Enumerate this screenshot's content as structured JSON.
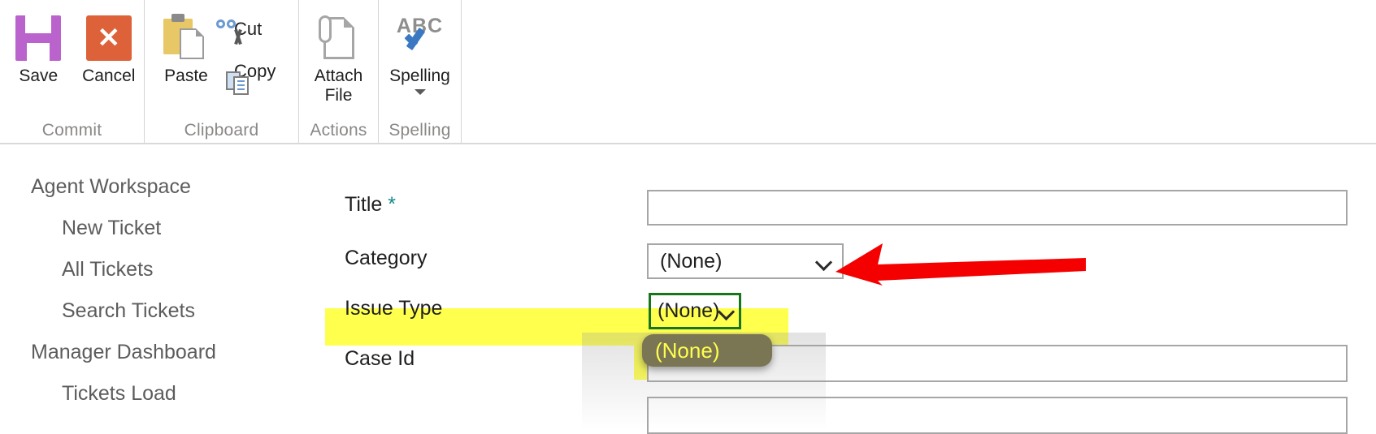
{
  "ribbon": {
    "groups": [
      {
        "label": "Commit",
        "buttons": [
          {
            "label": "Save",
            "icon": "floppy-disk-icon"
          },
          {
            "label": "Cancel",
            "icon": "cancel-x-icon"
          }
        ]
      },
      {
        "label": "Clipboard",
        "buttons": [
          {
            "label": "Paste",
            "icon": "clipboard-icon"
          },
          {
            "label": "Cut",
            "icon": "scissors-icon"
          },
          {
            "label": "Copy",
            "icon": "copy-pages-icon"
          }
        ]
      },
      {
        "label": "Actions",
        "buttons": [
          {
            "label": "Attach\nFile",
            "label_line1": "Attach",
            "label_line2": "File",
            "icon": "paperclip-document-icon"
          }
        ]
      },
      {
        "label": "Spelling",
        "buttons": [
          {
            "label": "Spelling",
            "icon": "abc-checkmark-icon"
          }
        ]
      }
    ]
  },
  "sidebar": {
    "items": [
      {
        "label": "Agent Workspace",
        "level": 1
      },
      {
        "label": "New Ticket",
        "level": 2
      },
      {
        "label": "All Tickets",
        "level": 2
      },
      {
        "label": "Search Tickets",
        "level": 2
      },
      {
        "label": "Manager Dashboard",
        "level": 1
      },
      {
        "label": "Tickets Load",
        "level": 2
      }
    ]
  },
  "form": {
    "fields": [
      {
        "label": "Title",
        "required_marker": "*",
        "type": "text",
        "value": ""
      },
      {
        "label": "Category",
        "type": "select",
        "value": "(None)"
      },
      {
        "label": "Issue Type",
        "type": "select",
        "value": "(None)",
        "highlighted": true,
        "expanded": true
      },
      {
        "label": "Case Id",
        "type": "text",
        "value": ""
      }
    ],
    "dropdown": {
      "open_for": "Issue Type",
      "options": [
        "(None)"
      ],
      "selected_option": "(None)"
    }
  },
  "annotations": {
    "arrow": {
      "points_to": "Category dropdown chevron",
      "color": "#f50000"
    },
    "highlight_color": "#ffff4d",
    "focus_outline_color": "#17761c"
  }
}
